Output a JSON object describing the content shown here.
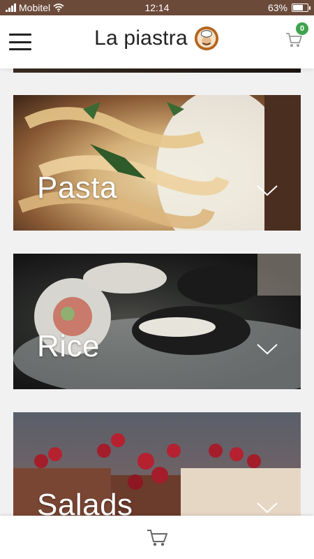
{
  "status": {
    "carrier": "Mobitel",
    "time": "12:14",
    "battery": "63%",
    "battery_level": 0.63
  },
  "header": {
    "title": "La piastra",
    "cart_count": "0"
  },
  "categories": [
    {
      "label": "Pasta"
    },
    {
      "label": "Rice"
    },
    {
      "label": "Salads"
    }
  ],
  "colors": {
    "badge": "#3fa34d",
    "status_bar": "#6b4a3a"
  }
}
